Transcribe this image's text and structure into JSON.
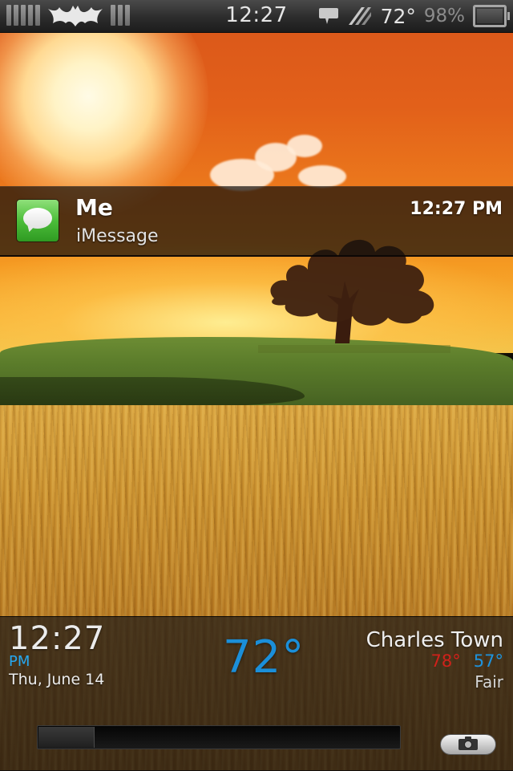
{
  "status_bar": {
    "time": "12:27",
    "temperature": "72°",
    "battery_percent": "98%",
    "carrier_logo": "bat-symbol-logo",
    "icons": [
      "signal-bars-icon",
      "bat-logo-icon",
      "signal-bars-icon",
      "message-bubble-icon",
      "weather-icon",
      "battery-icon"
    ]
  },
  "notification": {
    "sender": "Me",
    "app": "iMessage",
    "time": "12:27 PM",
    "icon": "imessage-app-icon"
  },
  "lockscreen": {
    "clock": {
      "time": "12:27",
      "ampm": "PM",
      "date": "Thu, June 14"
    },
    "weather": {
      "temperature": "72°",
      "city": "Charles Town",
      "high": "78°",
      "low": "57°",
      "condition": "Fair"
    },
    "unlock_slider": {
      "progress": 0
    },
    "camera_icon": "camera-icon"
  },
  "colors": {
    "clock_ampm": "#26a8f0",
    "weather_temp": "#1b8fd9",
    "weather_high": "#d0211a",
    "weather_low": "#1d93de"
  }
}
